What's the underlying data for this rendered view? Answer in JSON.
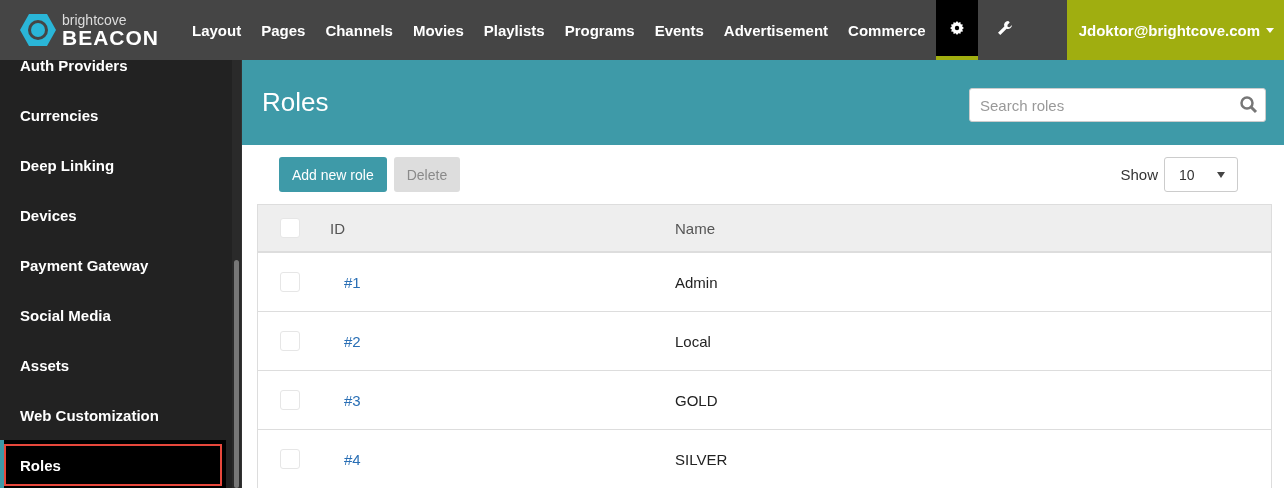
{
  "brand": {
    "line1": "brightcove",
    "line2": "BEACON"
  },
  "nav": [
    {
      "label": "Layout",
      "selected": false
    },
    {
      "label": "Pages",
      "selected": false
    },
    {
      "label": "Channels",
      "selected": false
    },
    {
      "label": "Movies",
      "selected": false
    },
    {
      "label": "Playlists",
      "selected": false
    },
    {
      "label": "Programs",
      "selected": false
    },
    {
      "label": "Events",
      "selected": false
    },
    {
      "label": "Advertisement",
      "selected": false
    },
    {
      "label": "Commerce",
      "selected": false
    }
  ],
  "tools": [
    {
      "kind": "settings",
      "selected": true
    },
    {
      "kind": "wrench",
      "selected": false
    }
  ],
  "user": {
    "label": "Jdoktor@brightcove.com"
  },
  "sidebar": {
    "items": [
      {
        "label": "Auth Providers",
        "selected": false
      },
      {
        "label": "Currencies",
        "selected": false
      },
      {
        "label": "Deep Linking",
        "selected": false
      },
      {
        "label": "Devices",
        "selected": false
      },
      {
        "label": "Payment Gateway",
        "selected": false
      },
      {
        "label": "Social Media",
        "selected": false
      },
      {
        "label": "Assets",
        "selected": false
      },
      {
        "label": "Web Customization",
        "selected": false
      },
      {
        "label": "Roles",
        "selected": true
      }
    ]
  },
  "page": {
    "title": "Roles",
    "search": {
      "placeholder": "Search roles"
    }
  },
  "buttons": [
    {
      "label": "Add new role",
      "disabled": false
    },
    {
      "label": "Delete",
      "disabled": true
    }
  ],
  "show": {
    "label": "Show",
    "value": "10"
  },
  "table": {
    "select_all": {
      "checked": false
    },
    "columns": [
      "ID",
      "Name"
    ],
    "rows": [
      {
        "id": "#1",
        "name": "Admin",
        "checked": false
      },
      {
        "id": "#2",
        "name": "Local",
        "checked": false
      },
      {
        "id": "#3",
        "name": "GOLD",
        "checked": false
      },
      {
        "id": "#4",
        "name": "SILVER",
        "checked": false
      }
    ]
  }
}
